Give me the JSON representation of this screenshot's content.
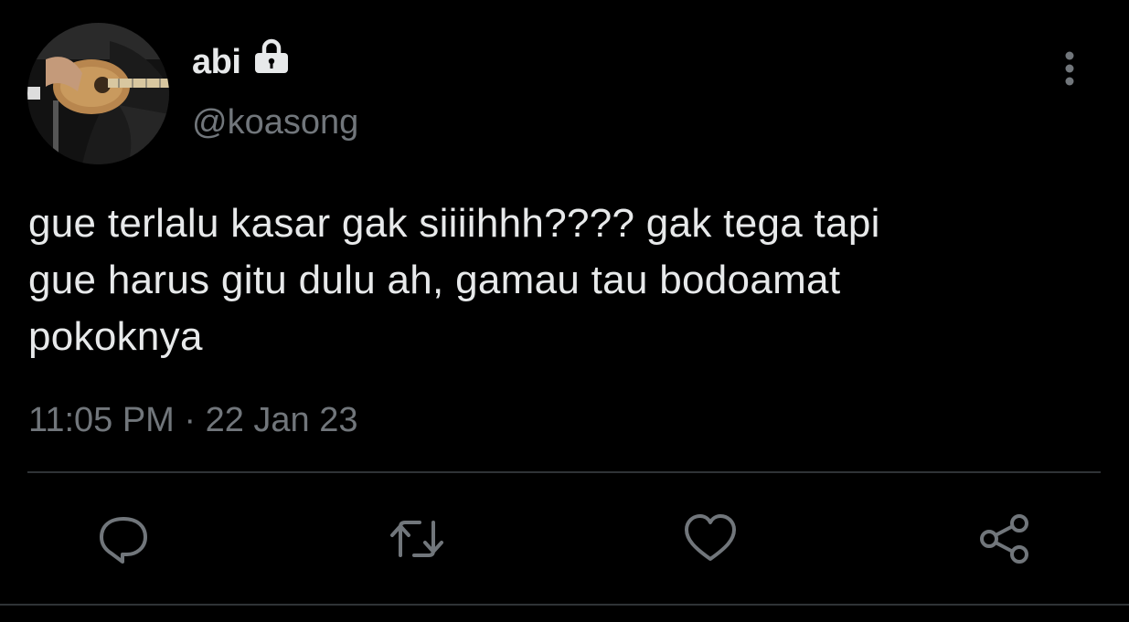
{
  "user": {
    "display_name": "abi",
    "handle": "@koasong",
    "protected": true,
    "avatar_icon": "guitar-player-photo"
  },
  "tweet": {
    "text": "gue terlalu kasar gak siiiihhh???? gak tega tapi\ngue harus gitu dulu ah, gamau tau bodoamat\npokoknya",
    "timestamp": "11:05 PM · 22 Jan 23"
  },
  "icons": {
    "lock": "lock-icon",
    "more": "more-vertical-icon",
    "reply": "reply-icon",
    "retweet": "retweet-icon",
    "like": "heart-icon",
    "share": "share-icon"
  },
  "colors": {
    "background": "#000000",
    "primary_text": "#e7e9ea",
    "secondary_text": "#71767b",
    "divider": "#2f3336"
  }
}
